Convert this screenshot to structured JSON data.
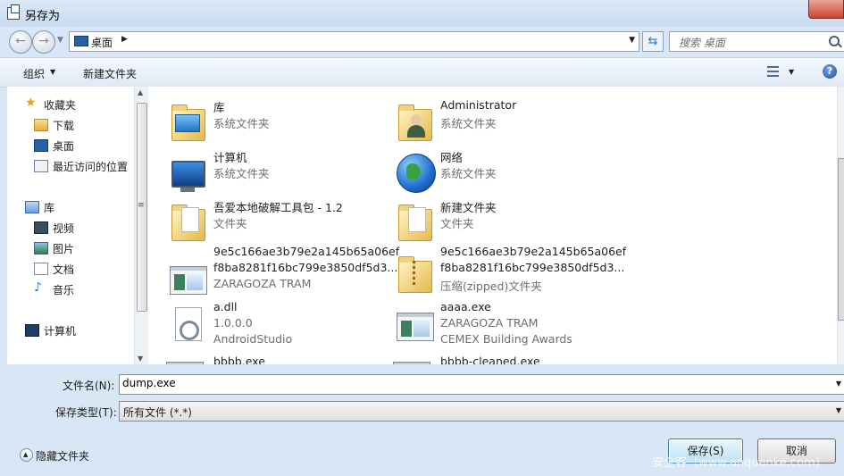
{
  "window": {
    "title": "另存为"
  },
  "address": {
    "path": "桌面",
    "search_placeholder": "搜索 桌面"
  },
  "toolbar": {
    "organize": "组织",
    "new_folder": "新建文件夹",
    "help": "?"
  },
  "nav": {
    "favorites": "收藏夹",
    "downloads": "下载",
    "desktop": "桌面",
    "recent": "最近访问的位置",
    "libraries": "库",
    "videos": "视频",
    "pictures": "图片",
    "documents": "文档",
    "music": "音乐",
    "computer": "计算机"
  },
  "files": [
    {
      "name": "库",
      "line2": "系统文件夹",
      "line3": ""
    },
    {
      "name": "Administrator",
      "line2": "系统文件夹",
      "line3": ""
    },
    {
      "name": "计算机",
      "line2": "系统文件夹",
      "line3": ""
    },
    {
      "name": "网络",
      "line2": "系统文件夹",
      "line3": ""
    },
    {
      "name": "吾爱本地破解工具包 - 1.2",
      "line2": "文件夹",
      "line3": ""
    },
    {
      "name": "新建文件夹",
      "line2": "文件夹",
      "line3": ""
    },
    {
      "name": "9e5c166ae3b79e2a145b65a06ef",
      "line2": "f8ba8281f16bc799e3850df5d3...",
      "line3": "ZARAGOZA TRAM"
    },
    {
      "name": "9e5c166ae3b79e2a145b65a06ef",
      "line2": "f8ba8281f16bc799e3850df5d3...",
      "line3": "压缩(zipped)文件夹"
    },
    {
      "name": "a.dll",
      "line2": "1.0.0.0",
      "line3": "AndroidStudio"
    },
    {
      "name": "aaaa.exe",
      "line2": "ZARAGOZA TRAM",
      "line3": "CEMEX Building Awards"
    },
    {
      "name": "bbbb.exe",
      "line2": "",
      "line3": ""
    },
    {
      "name": "bbbb-cleaned.exe",
      "line2": "",
      "line3": ""
    }
  ],
  "form": {
    "filename_label": "文件名(N):",
    "filename_value": "dump.exe",
    "filetype_label": "保存类型(T):",
    "filetype_value": "所有文件 (*.*)",
    "hide_folders": "隐藏文件夹",
    "save": "保存(S)",
    "cancel": "取消"
  },
  "watermark": "安全客（www.anquanke.com）"
}
